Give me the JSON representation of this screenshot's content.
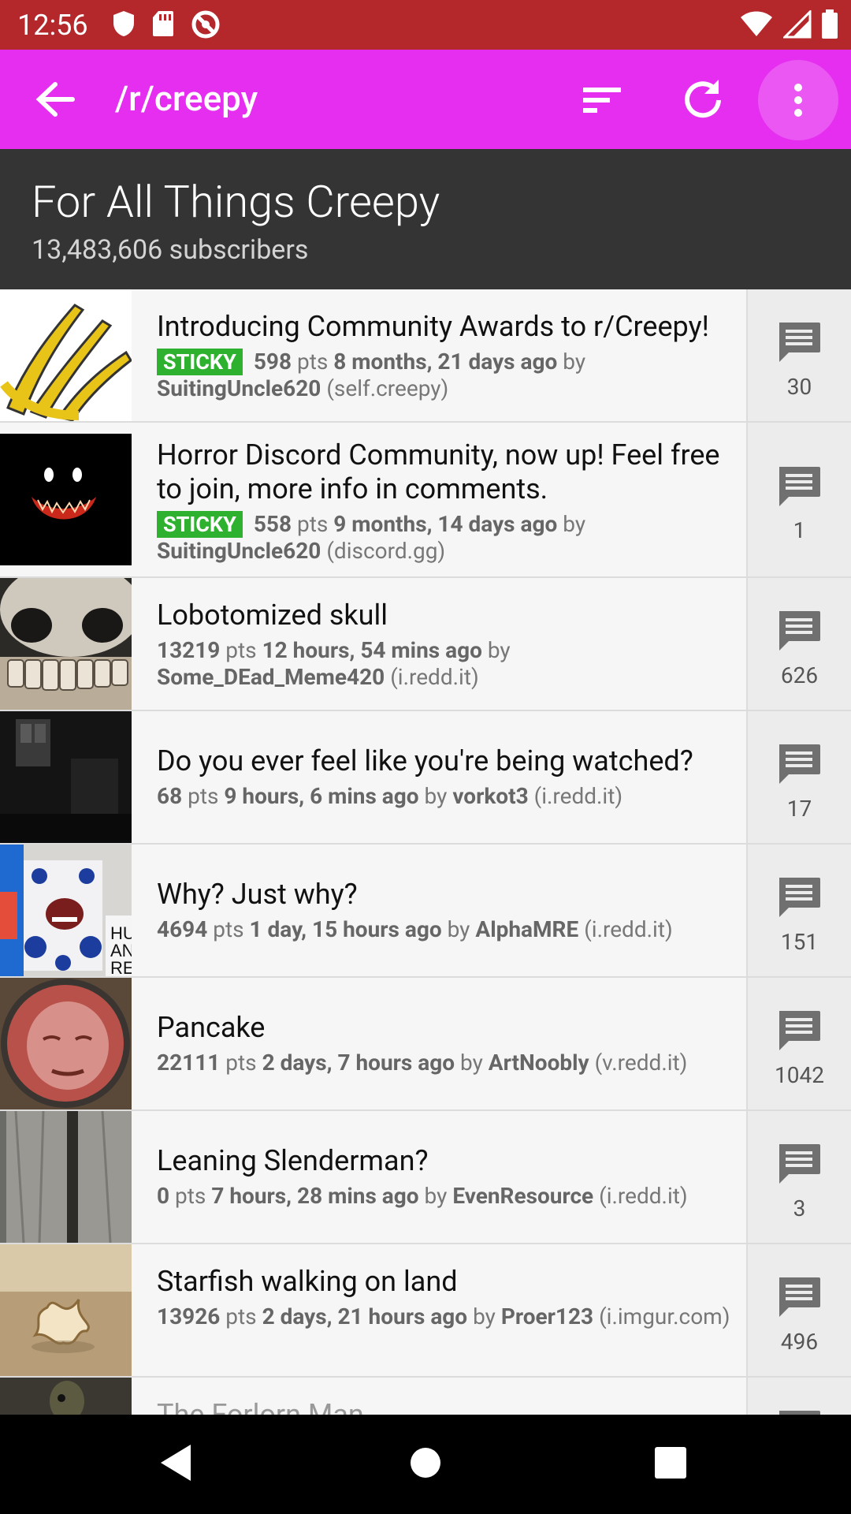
{
  "status_bar": {
    "time": "12:56"
  },
  "app_bar": {
    "title": "/r/creepy"
  },
  "subreddit": {
    "name": "For All Things Creepy",
    "subscribers": "13,483,606 subscribers"
  },
  "colors": {
    "status": "#b4272b",
    "app_bar": "#e62ef0",
    "header": "#343434",
    "sticky": "#2eb12e"
  },
  "posts": [
    {
      "title": "Introducing Community Awards to r/Creepy!",
      "sticky": "STICKY",
      "points": "598",
      "pts_label": "pts",
      "age": "8 months, 21 days ago",
      "by": "by",
      "author": "SuitingUncle620",
      "domain": "(self.creepy)",
      "comments": "30"
    },
    {
      "title": "Horror Discord Community, now up! Feel free to join, more info in comments.",
      "sticky": "STICKY",
      "points": "558",
      "pts_label": "pts",
      "age": "9 months, 14 days ago",
      "by": "by",
      "author": "SuitingUncle620",
      "domain": "(discord.gg)",
      "comments": "1"
    },
    {
      "title": "Lobotomized skull",
      "points": "13219",
      "pts_label": "pts",
      "age": "12 hours, 54 mins ago",
      "by": "by",
      "author": "Some_DEad_Meme420",
      "domain": "(i.redd.it)",
      "comments": "626"
    },
    {
      "title": "Do you ever feel like you're being watched?",
      "points": "68",
      "pts_label": "pts",
      "age": "9 hours, 6 mins ago",
      "by": "by",
      "author": "vorkot3",
      "domain": "(i.redd.it)",
      "comments": "17"
    },
    {
      "title": "Why? Just why?",
      "points": "4694",
      "pts_label": "pts",
      "age": "1 day, 15 hours ago",
      "by": "by",
      "author": "AlphaMRE",
      "domain": "(i.redd.it)",
      "comments": "151"
    },
    {
      "title": "Pancake",
      "points": "22111",
      "pts_label": "pts",
      "age": "2 days, 7 hours ago",
      "by": "by",
      "author": "ArtNoobly",
      "domain": "(v.redd.it)",
      "comments": "1042"
    },
    {
      "title": "Leaning Slenderman?",
      "points": "0",
      "pts_label": "pts",
      "age": "7 hours, 28 mins ago",
      "by": "by",
      "author": "EvenResource",
      "domain": "(i.redd.it)",
      "comments": "3"
    },
    {
      "title": "Starfish walking on land",
      "points": "13926",
      "pts_label": "pts",
      "age": "2 days, 21 hours ago",
      "by": "by",
      "author": "Proer123",
      "domain": "(i.imgur.com)",
      "comments": "496"
    },
    {
      "title": "The Forlorn Man"
    }
  ]
}
